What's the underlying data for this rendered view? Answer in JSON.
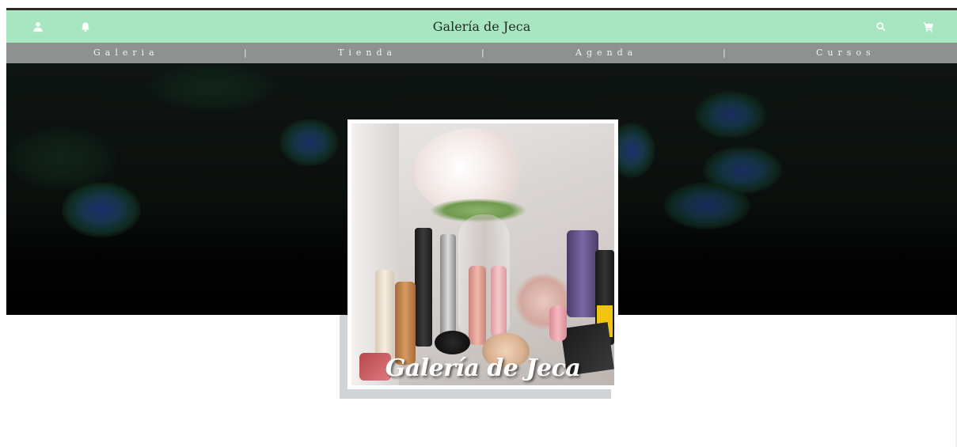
{
  "header": {
    "title": "Galería de Jeca",
    "icons": [
      "user-icon",
      "bell-icon",
      "search-icon",
      "cart-icon"
    ],
    "background": "#a8e6c2"
  },
  "nav": {
    "items": [
      "Galeria",
      "Tienda",
      "Agenda",
      "Cursos"
    ],
    "separator": "|",
    "background": "#8d9290"
  },
  "hero": {
    "caption": "Galería de Jeca"
  }
}
